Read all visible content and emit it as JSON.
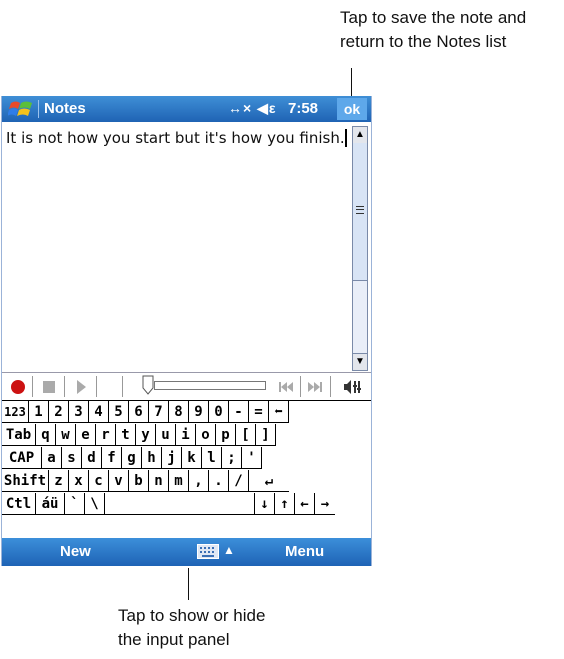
{
  "callouts": {
    "ok_line1": "Tap to save the note and",
    "ok_line2": "return to the Notes list",
    "panel_line1": "Tap to show or hide",
    "panel_line2": "the input panel"
  },
  "titlebar": {
    "app_title": "Notes",
    "status": "↔× ◀ε",
    "time": "7:58",
    "ok_label": "ok"
  },
  "note": {
    "text": "It is not how you start but it's how you finish."
  },
  "keyboard": {
    "rows": [
      [
        "123",
        "1",
        "2",
        "3",
        "4",
        "5",
        "6",
        "7",
        "8",
        "9",
        "0",
        "-",
        "=",
        "⬅"
      ],
      [
        "Tab",
        "q",
        "w",
        "e",
        "r",
        "t",
        "y",
        "u",
        "i",
        "o",
        "p",
        "[",
        "]"
      ],
      [
        "CAP",
        "a",
        "s",
        "d",
        "f",
        "g",
        "h",
        "j",
        "k",
        "l",
        ";",
        "'"
      ],
      [
        "Shift",
        "z",
        "x",
        "c",
        "v",
        "b",
        "n",
        "m",
        ",",
        ".",
        "/",
        "↵"
      ],
      [
        "Ctl",
        "áü",
        "`",
        "\\",
        "",
        "↓",
        "↑",
        "←",
        "→"
      ]
    ]
  },
  "menubar": {
    "left": "New",
    "right": "Menu",
    "panel_arrow": "▲"
  },
  "colors": {
    "titlebar": "#2a74c6",
    "menubar": "#2a74c6",
    "record": "#cc1111"
  }
}
